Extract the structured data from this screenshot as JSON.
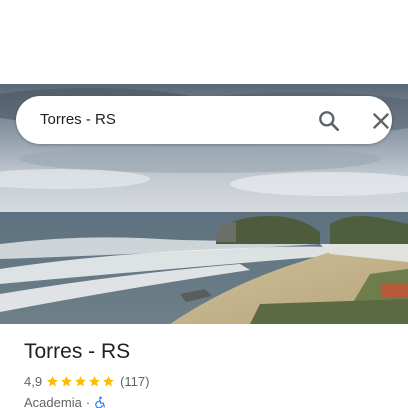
{
  "search": {
    "query": "Torres - RS",
    "search_icon": "search-icon",
    "close_icon": "close-icon"
  },
  "place": {
    "title": "Torres - RS",
    "rating": "4,9",
    "stars": 5,
    "review_count": "(117)",
    "category": "Academia",
    "separator": "·",
    "accessibility_icon": "wheelchair-icon"
  },
  "colors": {
    "star": "#fbbc04",
    "accessibility": "#1a73e8",
    "text_primary": "#202124",
    "text_secondary": "#5f6368"
  }
}
